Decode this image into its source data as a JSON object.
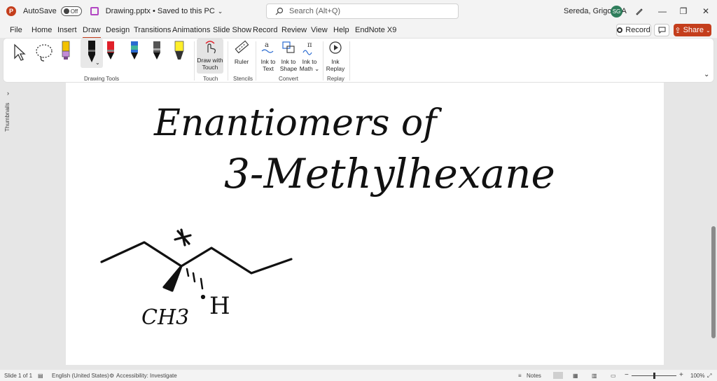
{
  "titlebar": {
    "autosave_label": "AutoSave",
    "autosave_state": "Off",
    "document": "Drawing.pptx • Saved to this PC",
    "search_placeholder": "Search (Alt+Q)",
    "user": "Sereda, Grigoriy A",
    "avatar_initials": "SG"
  },
  "menu": {
    "tabs": [
      "File",
      "Home",
      "Insert",
      "Draw",
      "Design",
      "Transitions",
      "Animations",
      "Slide Show",
      "Record",
      "Review",
      "View",
      "Help",
      "EndNote X9"
    ],
    "active_tab": "Draw",
    "record_label": "Record",
    "share_label": "Share"
  },
  "ribbon": {
    "groups": {
      "drawing_tools": "Drawing Tools",
      "touch": "Touch",
      "stencils": "Stencils",
      "convert": "Convert",
      "replay": "Replay"
    },
    "draw_with_touch": [
      "Draw with",
      "Touch"
    ],
    "ruler": "Ruler",
    "ink_to_text": [
      "Ink to",
      "Text"
    ],
    "ink_to_shape": [
      "Ink to",
      "Shape"
    ],
    "ink_to_math": [
      "Ink to",
      "Math"
    ],
    "ink_replay": [
      "Ink",
      "Replay"
    ]
  },
  "pens": [
    {
      "name": "yellow-lavender-pen",
      "color": "#f2c200"
    },
    {
      "name": "black-pen",
      "color": "#111111"
    },
    {
      "name": "red-pen",
      "color": "#e0202a"
    },
    {
      "name": "galaxy-pen",
      "color": "#2a6bd1"
    },
    {
      "name": "gray-pen",
      "color": "#555555"
    },
    {
      "name": "yellow-highlighter",
      "color": "#ffef2a"
    }
  ],
  "sidebar": {
    "thumbnails_label": "Thumbnails"
  },
  "slide": {
    "handwriting_line1": "Enantiomers of",
    "handwriting_line2": "3-Methylhexane",
    "substituent": "CH3",
    "hydrogen": "H"
  },
  "status": {
    "slide": "Slide 1 of 1",
    "language": "English (United States)",
    "accessibility": "Accessibility: Investigate",
    "notes": "Notes",
    "zoom": "100%"
  },
  "colors": {
    "accent": "#c43e1c",
    "ink": "#111111"
  }
}
